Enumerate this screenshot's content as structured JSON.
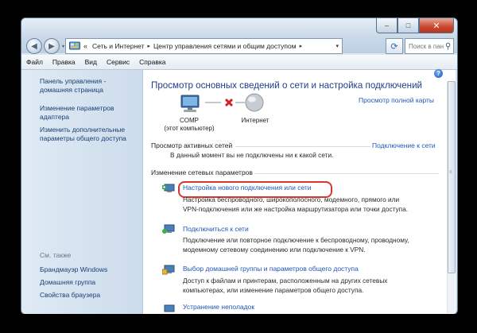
{
  "window": {
    "controls": {
      "minimize": "–",
      "maximize": "□",
      "close": "✕"
    }
  },
  "address": {
    "root_chevron": "«",
    "segments": [
      "Сеть и Интернет",
      "Центр управления сетями и общим доступом"
    ],
    "separator": "▸",
    "dropdown": "▾"
  },
  "search": {
    "placeholder": "Поиск в панели управл..."
  },
  "menu": [
    "Файл",
    "Правка",
    "Вид",
    "Сервис",
    "Справка"
  ],
  "sidebar": {
    "home": "Панель управления - домашняя страница",
    "home_line1": "Панель управления -",
    "home_line2": "домашняя страница",
    "adapter_line1": "Изменение параметров",
    "adapter_line2": "адаптера",
    "sharing_line1": "Изменить дополнительные",
    "sharing_line2": "параметры общего доступа",
    "see_also": "См. также",
    "see_also_items": [
      "Брандмауэр Windows",
      "Домашняя группа",
      "Свойства браузера"
    ]
  },
  "main": {
    "heading": "Просмотр основных сведений о сети и настройка подключений",
    "full_map_link": "Просмотр полной карты",
    "computer_label1": "COMP",
    "computer_label2": "(этот компьютер)",
    "internet_label": "Интернет",
    "active_networks_title": "Просмотр активных сетей",
    "connect_link": "Подключение к сети",
    "not_connected": "В данный момент вы не подключены ни к какой сети.",
    "change_settings_title": "Изменение сетевых параметров",
    "tasks": [
      {
        "title": "Настройка нового подключения или сети",
        "desc1": "Настройка беспроводного, широкополосного, модемного, прямого или",
        "desc2": "VPN-подключения или же настройка маршрутизатора или точки доступа."
      },
      {
        "title": "Подключиться к сети",
        "desc1": "Подключение или повторное подключение к беспроводному, проводному,",
        "desc2": "модемному сетевому соединению или подключение к VPN."
      },
      {
        "title": "Выбор домашней группы и параметров общего доступа",
        "desc1": "Доступ к файлам и принтерам, расположенным на других сетевых",
        "desc2": "компьютерах, или изменение параметров общего доступа."
      },
      {
        "title": "Устранение неполадок"
      }
    ],
    "help": "?"
  },
  "colors": {
    "link": "#1f57b8",
    "heading": "#1e3f8a",
    "highlight_ring": "#d8352d",
    "sidebar_link": "#173f73",
    "disconnect_x": "#d0222a"
  },
  "icons": {
    "back": "back-arrow-icon",
    "forward": "forward-arrow-icon",
    "refresh": "refresh-icon",
    "search": "search-icon",
    "help": "help-icon",
    "computer": "computer-icon",
    "globe": "globe-icon",
    "disconnected": "red-x-icon"
  }
}
